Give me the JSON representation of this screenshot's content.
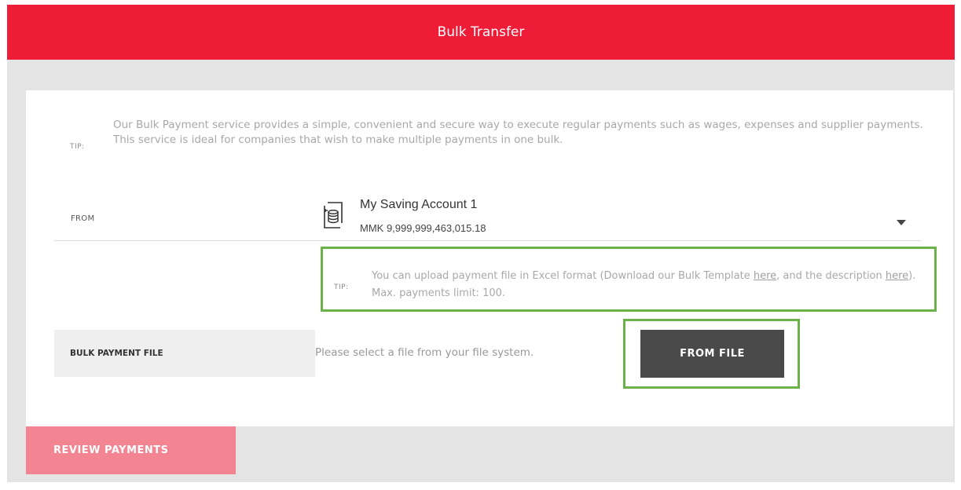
{
  "header": {
    "title": "Bulk Transfer"
  },
  "intro_tip": {
    "label": "TIP:",
    "text": "Our Bulk Payment service provides a simple, convenient and secure way to execute regular payments such as wages, expenses and supplier payments. This service is ideal for companies that wish to make multiple payments in one bulk."
  },
  "from_field": {
    "label": "FROM",
    "account_name": "My Saving Account 1",
    "account_balance": "MMK 9,999,999,463,015.18"
  },
  "upload_tip": {
    "label": "TIP:",
    "text_1": "You can upload payment file in Excel format (Download our Bulk Template ",
    "link_1": "here",
    "text_2": ", and the description ",
    "link_2": "here",
    "text_3": "). Max. payments limit: 100."
  },
  "bulk_file": {
    "label": "BULK PAYMENT FILE",
    "hint": "Please select a file from your file system.",
    "button_label": "FROM FILE"
  },
  "footer": {
    "review_button_label": "REVIEW PAYMENTS"
  },
  "colors": {
    "brand_red": "#ee1c36",
    "review_button": "#f28591",
    "highlight_green": "#6cb24a",
    "dark_button": "#4a4a4a"
  }
}
